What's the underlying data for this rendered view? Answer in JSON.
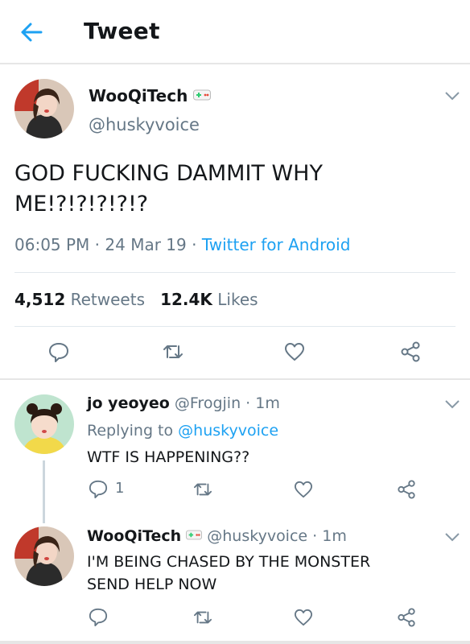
{
  "header": {
    "title": "Tweet"
  },
  "main_tweet": {
    "author_name": "WooQiTech",
    "badge_icon": "game-controller-emoji",
    "handle": "@huskyvoice",
    "text_line1": "GOD FUCKING DAMMIT WHY",
    "text_line2": "ME!?!?!?!?!?",
    "time": "06:05 PM",
    "date": "24 Mar 19",
    "source": "Twitter for Android",
    "retweets_count": "4,512",
    "retweets_label": "Retweets",
    "likes_count": "12.4K",
    "likes_label": "Likes"
  },
  "replies": [
    {
      "author_name": "jo yeoyeo",
      "handle": "@Frogjin",
      "time": "1m",
      "replying_prefix": "Replying to",
      "replying_to": "@huskyvoice",
      "text": "WTF IS HAPPENING??",
      "reply_count": "1"
    },
    {
      "author_name": "WooQiTech",
      "badge_icon": "game-controller-emoji",
      "handle": "@huskyvoice",
      "time": "1m",
      "text_line1": "I'M BEING CHASED BY THE MONSTER",
      "text_line2": "SEND HELP NOW"
    }
  ],
  "colors": {
    "accent": "#1da1f2",
    "text": "#14171a",
    "muted": "#657786",
    "divider": "#e1e8ed"
  },
  "icons": [
    "back-arrow-icon",
    "chevron-down-icon",
    "reply-icon",
    "retweet-icon",
    "like-icon",
    "share-icon"
  ]
}
